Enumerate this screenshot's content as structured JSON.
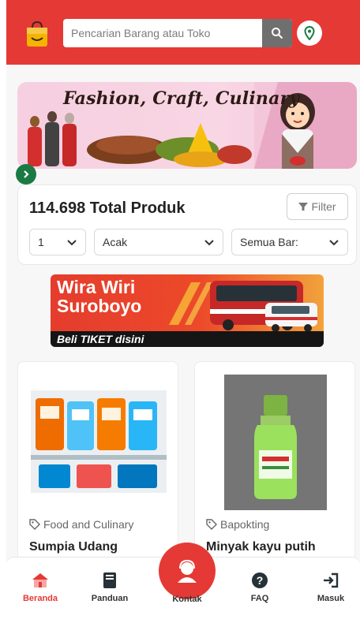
{
  "colors": {
    "brand_red": "#e53935",
    "green": "#1b7a44"
  },
  "header": {
    "search_placeholder": "Pencarian Barang atau Toko",
    "icons": [
      "shopping-bag-icon",
      "search-icon",
      "location-pin-icon"
    ]
  },
  "hero_banner": {
    "text": "Fashion, Craft, Culinary"
  },
  "product_summary": {
    "total": "114.698 Total Produk",
    "filter_label": "Filter",
    "select_page": "1",
    "select_sort": "Acak",
    "select_category": "Semua Bar:"
  },
  "promo_banner": {
    "title_line1": "Wira Wiri",
    "title_line2": "Suroboyo",
    "cta": "Beli TIKET disini"
  },
  "products": [
    {
      "category": "Food and Culinary",
      "name": "Sumpia Udang"
    },
    {
      "category": "Bapokting",
      "name": "Minyak kayu putih"
    }
  ],
  "bottom_nav": {
    "items": [
      {
        "label": "Beranda",
        "icon": "home-icon",
        "active": true
      },
      {
        "label": "Panduan",
        "icon": "book-icon"
      },
      {
        "label": "Kontak",
        "icon": "contact-icon"
      },
      {
        "label": "FAQ",
        "icon": "question-icon"
      },
      {
        "label": "Masuk",
        "icon": "login-icon"
      }
    ]
  }
}
